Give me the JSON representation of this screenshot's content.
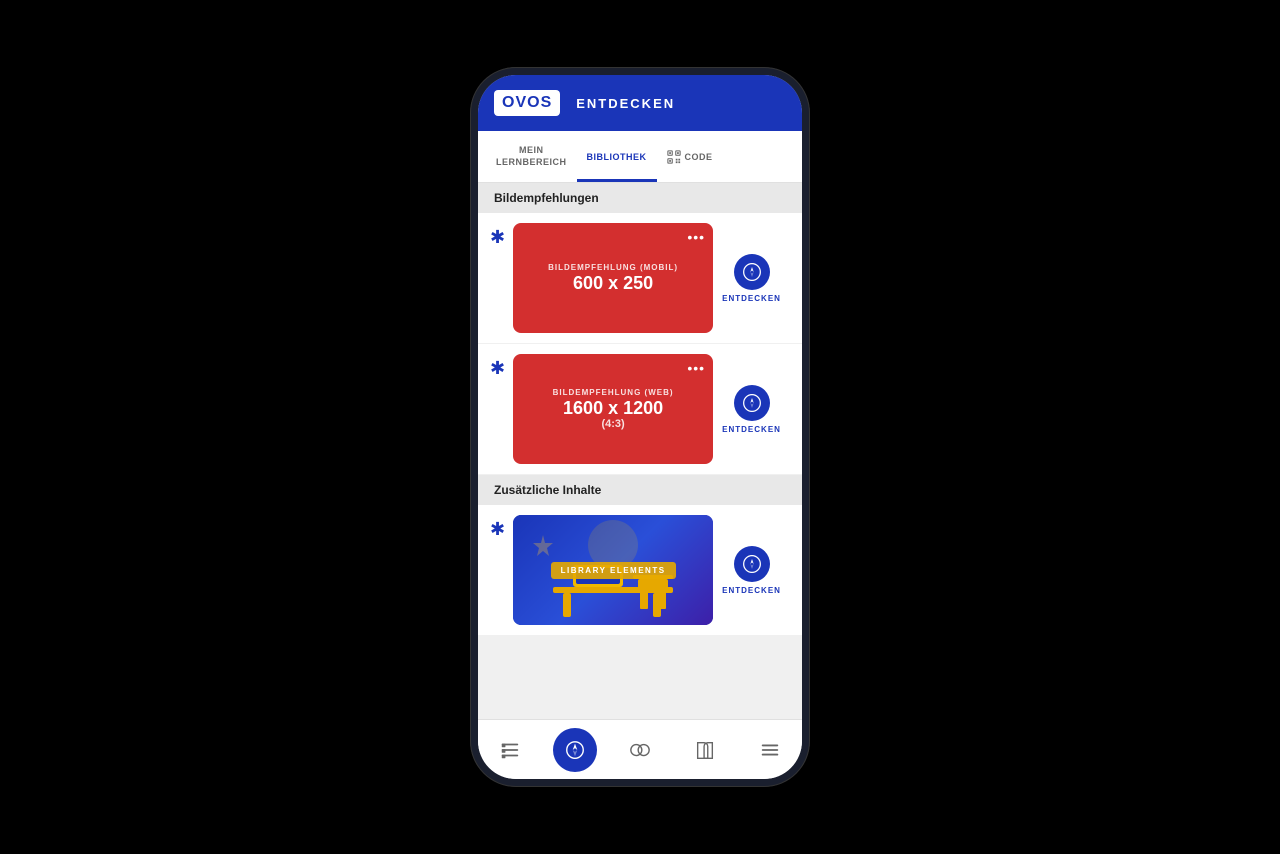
{
  "app": {
    "logo": "OVOS",
    "header_title": "ENTDECKEN"
  },
  "tabs": [
    {
      "id": "mein",
      "label_line1": "MEIN",
      "label_line2": "LERNBEREICH",
      "active": false
    },
    {
      "id": "bibliothek",
      "label": "BIBLIOTHEK",
      "active": true
    },
    {
      "id": "code",
      "label": "CODE",
      "active": false
    }
  ],
  "sections": [
    {
      "id": "bildempfehlungen",
      "title": "Bildempfehlungen",
      "cards": [
        {
          "id": "card-mobil",
          "type": "red",
          "label_small": "BILDEMPFEHLUNG (MOBIL)",
          "label_big": "600 x 250",
          "action_label": "ENTDECKEN"
        },
        {
          "id": "card-web",
          "type": "red",
          "label_small": "BILDEMPFEHLUNG (WEB)",
          "label_big": "1600 x 1200",
          "label_sub": "(4:3)",
          "action_label": "ENTDECKEN"
        }
      ]
    },
    {
      "id": "zusaetzliche",
      "title": "Zusätzliche Inhalte",
      "cards": [
        {
          "id": "card-library",
          "type": "library",
          "label": "LIBRARY ELEMENTS",
          "action_label": "ENTDECKEN"
        }
      ]
    }
  ],
  "bottom_nav": [
    {
      "id": "nav-list",
      "icon": "list-icon",
      "active": false
    },
    {
      "id": "nav-compass",
      "icon": "compass-icon",
      "active": true
    },
    {
      "id": "nav-split",
      "icon": "split-icon",
      "active": false
    },
    {
      "id": "nav-book",
      "icon": "book-icon",
      "active": false
    },
    {
      "id": "nav-menu",
      "icon": "menu-icon",
      "active": false
    }
  ],
  "icons": {
    "compass": "compass",
    "qr": "qr"
  }
}
